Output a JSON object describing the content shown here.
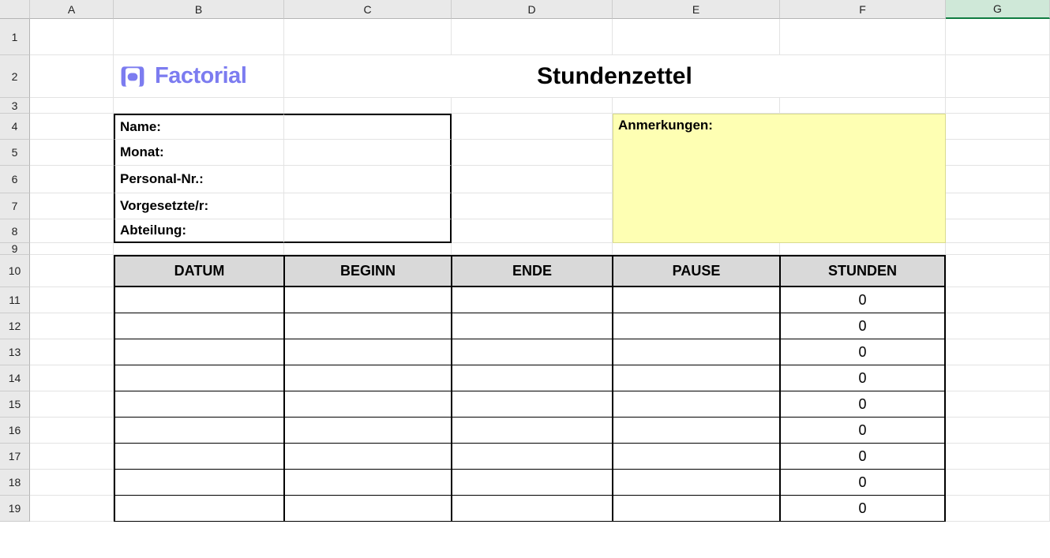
{
  "columns": [
    "A",
    "B",
    "C",
    "D",
    "E",
    "F",
    "G"
  ],
  "rows": [
    "1",
    "2",
    "3",
    "4",
    "5",
    "6",
    "7",
    "8",
    "9",
    "10",
    "11",
    "12",
    "13",
    "14",
    "15",
    "16",
    "17",
    "18",
    "19"
  ],
  "selected_column": "G",
  "logo_text": "Factorial",
  "title": "Stundenzettel",
  "info": {
    "name_label": "Name:",
    "name_value": "",
    "month_label": "Monat:",
    "month_value": "",
    "personal_label": "Personal-Nr.:",
    "personal_value": "",
    "supervisor_label": "Vorgesetzte/r:",
    "supervisor_value": "",
    "department_label": "Abteilung:",
    "department_value": ""
  },
  "notes_label": "Anmerkungen:",
  "notes_value": "",
  "table": {
    "headers": {
      "date": "DATUM",
      "begin": "BEGINN",
      "end": "ENDE",
      "pause": "PAUSE",
      "hours": "STUNDEN"
    },
    "rows": [
      {
        "date": "",
        "begin": "",
        "end": "",
        "pause": "",
        "hours": "0"
      },
      {
        "date": "",
        "begin": "",
        "end": "",
        "pause": "",
        "hours": "0"
      },
      {
        "date": "",
        "begin": "",
        "end": "",
        "pause": "",
        "hours": "0"
      },
      {
        "date": "",
        "begin": "",
        "end": "",
        "pause": "",
        "hours": "0"
      },
      {
        "date": "",
        "begin": "",
        "end": "",
        "pause": "",
        "hours": "0"
      },
      {
        "date": "",
        "begin": "",
        "end": "",
        "pause": "",
        "hours": "0"
      },
      {
        "date": "",
        "begin": "",
        "end": "",
        "pause": "",
        "hours": "0"
      },
      {
        "date": "",
        "begin": "",
        "end": "",
        "pause": "",
        "hours": "0"
      },
      {
        "date": "",
        "begin": "",
        "end": "",
        "pause": "",
        "hours": "0"
      }
    ]
  }
}
